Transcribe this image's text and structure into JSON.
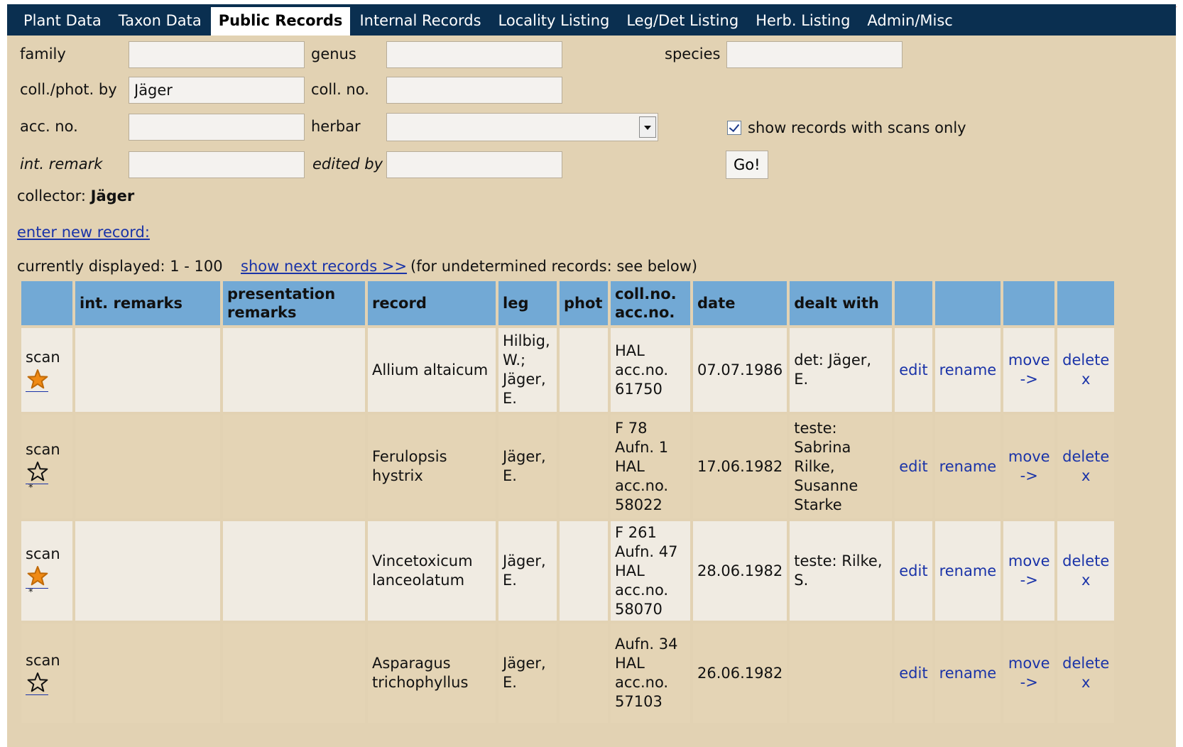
{
  "nav": {
    "tabs": [
      {
        "label": "Plant Data"
      },
      {
        "label": "Taxon Data"
      },
      {
        "label": "Public Records",
        "active": true
      },
      {
        "label": "Internal Records"
      },
      {
        "label": "Locality Listing"
      },
      {
        "label": "Leg/Det Listing"
      },
      {
        "label": "Herb. Listing"
      },
      {
        "label": "Admin/Misc"
      }
    ]
  },
  "search": {
    "family_label": "family",
    "family_value": "",
    "genus_label": "genus",
    "genus_value": "",
    "species_label": "species",
    "species_value": "",
    "coll_label": "coll./phot. by",
    "coll_value": "Jäger",
    "collno_label": "coll. no.",
    "collno_value": "",
    "accno_label": "acc. no.",
    "accno_value": "",
    "herbar_label": "herbar",
    "herbar_value": "",
    "scans_only_label": "show records with scans only",
    "scans_only_checked": true,
    "intremark_label": "int. remark",
    "intremark_value": "",
    "editedby_label": "edited by",
    "editedby_value": "",
    "go_label": "Go!"
  },
  "collector": {
    "prefix": "collector: ",
    "name": "Jäger"
  },
  "new_record_link": "enter new record:",
  "pagination": {
    "displayed": "currently displayed: 1 - 100",
    "next_link": "show next records >>",
    "note": "(for undetermined records: see below)"
  },
  "table": {
    "headers": {
      "scan": "",
      "int_remarks": "int. remarks",
      "presentation_remarks_1": "presentation",
      "presentation_remarks_2": "remarks",
      "record": "record",
      "leg": "leg",
      "phot": "phot",
      "collno_1": "coll.no.",
      "collno_2": "acc.no.",
      "date": "date",
      "dealt_with": "dealt with",
      "edit": "",
      "rename": "",
      "move": "",
      "delete": ""
    },
    "rows": [
      {
        "scan": "scan",
        "star": "filled",
        "starnote": "",
        "int_remarks": "",
        "presentation_remarks": "",
        "record": [
          "Allium altaicum"
        ],
        "leg": [
          "Hilbig,",
          "W.;",
          "Jäger,",
          "E."
        ],
        "phot": "",
        "collno": [
          "HAL",
          "acc.no.",
          "61750"
        ],
        "date": "07.07.1986",
        "dealt_with": [
          "det: Jäger, E."
        ],
        "edit": "edit",
        "rename": "rename",
        "move": [
          "move",
          "->"
        ],
        "delete": [
          "delete",
          "x"
        ]
      },
      {
        "scan": "scan",
        "star": "empty",
        "starnote": "*",
        "int_remarks": "",
        "presentation_remarks": "",
        "record": [
          "Ferulopsis",
          "hystrix"
        ],
        "leg": [
          "Jäger,",
          "E."
        ],
        "phot": "",
        "collno": [
          "F 78",
          "Aufn. 1",
          "HAL",
          "acc.no.",
          "58022"
        ],
        "date": "17.06.1982",
        "dealt_with": [
          "teste:",
          "Sabrina",
          "Rilke,",
          "Susanne",
          "Starke"
        ],
        "edit": "edit",
        "rename": "rename",
        "move": [
          "move",
          "->"
        ],
        "delete": [
          "delete",
          "x"
        ]
      },
      {
        "scan": "scan",
        "star": "filled",
        "starnote": "*",
        "int_remarks": "",
        "presentation_remarks": "",
        "record": [
          "Vincetoxicum",
          "lanceolatum"
        ],
        "leg": [
          "Jäger,",
          "E."
        ],
        "phot": "",
        "collno": [
          "F 261",
          "Aufn. 47",
          "HAL",
          "acc.no.",
          "58070"
        ],
        "date": "28.06.1982",
        "dealt_with": [
          "teste: Rilke,",
          "S."
        ],
        "edit": "edit",
        "rename": "rename",
        "move": [
          "move",
          "->"
        ],
        "delete": [
          "delete",
          "x"
        ]
      },
      {
        "scan": "scan",
        "star": "empty",
        "starnote": "",
        "int_remarks": "",
        "presentation_remarks": "",
        "record": [
          "Asparagus",
          "trichophyllus"
        ],
        "leg": [
          "Jäger,",
          "E."
        ],
        "phot": "",
        "collno": [
          "Aufn. 34",
          "HAL",
          "acc.no.",
          "57103"
        ],
        "date": "26.06.1982",
        "dealt_with": [
          ""
        ],
        "edit": "edit",
        "rename": "rename",
        "move": [
          "move",
          "->"
        ],
        "delete": [
          "delete",
          "x"
        ]
      }
    ]
  },
  "colors": {
    "nav_bg": "#0a2f50",
    "page_bg": "#e2d2b3",
    "header_bg": "#72a9d5",
    "link": "#1a33a8",
    "star_filled": "#f08a14"
  }
}
